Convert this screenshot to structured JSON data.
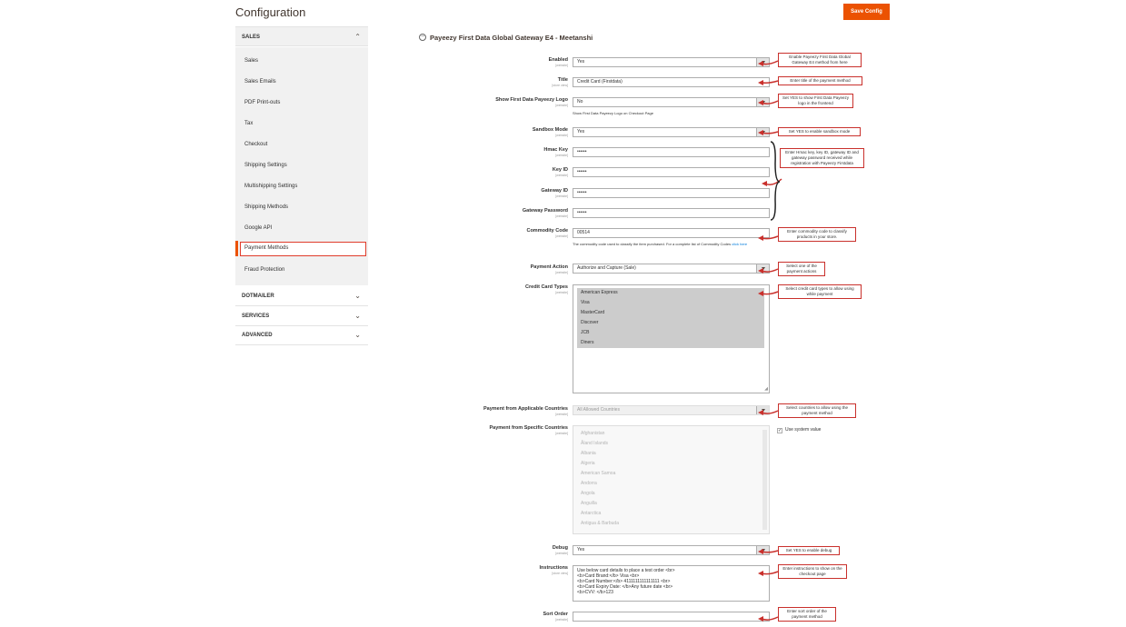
{
  "header": {
    "title": "Configuration",
    "save_label": "Save Config"
  },
  "sidebar": {
    "sales_head": "SALES",
    "items": [
      "Sales",
      "Sales Emails",
      "PDF Print-outs",
      "Tax",
      "Checkout",
      "Shipping Settings",
      "Multishipping Settings",
      "Shipping Methods",
      "Google API",
      "Payment Methods",
      "Fraud Protection"
    ],
    "sections": [
      "DOTMAILER",
      "SERVICES",
      "ADVANCED"
    ]
  },
  "section_title": "Payeezy First Data Global Gateway E4 - Meetanshi",
  "fields": {
    "enabled": {
      "label": "Enabled",
      "scope": "[website]",
      "value": "Yes"
    },
    "title": {
      "label": "Title",
      "scope": "[store view]",
      "value": "Credit Card (Firstdata)"
    },
    "logo": {
      "label": "Show First Data Payeezy Logo",
      "scope": "[website]",
      "value": "No",
      "note": "Show First Data Payeezy Logo on Checkout Page"
    },
    "sandbox": {
      "label": "Sandbox Mode",
      "scope": "[website]",
      "value": "Yes"
    },
    "hmac": {
      "label": "Hmac Key",
      "scope": "[website]",
      "value": "••••••"
    },
    "keyid": {
      "label": "Key ID",
      "scope": "[website]",
      "value": "••••••"
    },
    "gatewayid": {
      "label": "Gateway ID",
      "scope": "[website]",
      "value": "••••••"
    },
    "gatewaypw": {
      "label": "Gateway Password",
      "scope": "[website]",
      "value": "••••••"
    },
    "commodity": {
      "label": "Commodity Code",
      "scope": "[website]",
      "value": "00514",
      "note": "The commodity code used to classify the item purchased. For a complete list of Commodity Codes",
      "note_link": "click here"
    },
    "action": {
      "label": "Payment Action",
      "scope": "[website]",
      "value": "Authorize and Capture (Sale)"
    },
    "cctypes": {
      "label": "Credit Card Types",
      "scope": "[website]",
      "options": [
        "American Express",
        "Visa",
        "MasterCard",
        "Discover",
        "JCB",
        "Diners"
      ]
    },
    "applicable": {
      "label": "Payment from Applicable Countries",
      "scope": "[website]",
      "value": "All Allowed Countries"
    },
    "specific": {
      "label": "Payment from Specific Countries",
      "scope": "[website]",
      "options": [
        "Afghanistan",
        "Åland Islands",
        "Albania",
        "Algeria",
        "American Samoa",
        "Andorra",
        "Angola",
        "Anguilla",
        "Antarctica",
        "Antigua & Barbuda"
      ],
      "use_system": "Use system value"
    },
    "debug": {
      "label": "Debug",
      "scope": "[website]",
      "value": "Yes"
    },
    "instructions": {
      "label": "Instructions",
      "scope": "[store view]",
      "value": "Use below card details to place a test order <br>\n<b>Card Brand:</b> Visa <br>\n<b>Card Number:</b> 4111111111111111 <br>\n<b>Card Expiry Date: </b>Any future date <br>\n<b>CVV: </b>123"
    },
    "sort": {
      "label": "Sort Order",
      "scope": "[website]",
      "value": ""
    }
  },
  "annotations": {
    "enabled": "Enable Payeezy First Data Global Gateway E4 method from here",
    "title": "Enter title of the payment method",
    "logo": "Set YES to show First Data Payeezy logo in the frontend",
    "sandbox": "Set YES to enable sandbox mode",
    "credentials": "Enter Hmac key, key ID, gateway ID and gateway password received while registration with Payeezy Firstdata",
    "commodity": "Enter commodity code to classify products in your store.",
    "action": "Select one of the payment actions",
    "cctypes": "Select credit card types to allow using while payment",
    "countries": "Select countries to allow using the payment method",
    "debug": "Set YES to enable debug",
    "instructions": "Enter instructions to show on the checkout page",
    "sort": "Enter sort order of the payment method"
  },
  "colors": {
    "accent": "#eb5202",
    "annotation_border": "#c9302c"
  }
}
